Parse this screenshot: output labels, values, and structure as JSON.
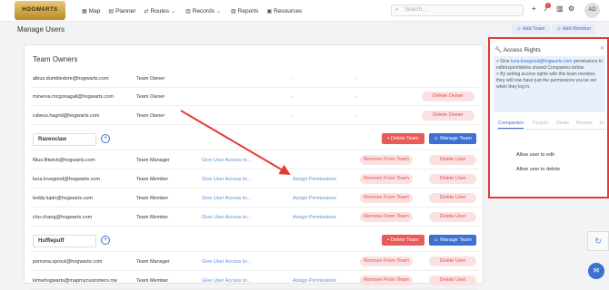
{
  "logo_text": "HOGWARTS",
  "nav": [
    {
      "label": "Map",
      "icon": "map-icon"
    },
    {
      "label": "Planner",
      "icon": "calendar-icon"
    },
    {
      "label": "Routes",
      "icon": "routes-icon"
    },
    {
      "label": "Records",
      "icon": "records-icon"
    },
    {
      "label": "Reports",
      "icon": "reports-icon"
    },
    {
      "label": "Resources",
      "icon": "resources-icon"
    }
  ],
  "search": {
    "placeholder": "Search..."
  },
  "notifications_count": "2",
  "avatar_initials": "AD",
  "page_title": "Manage Users",
  "actions": {
    "add_team": "Add Team",
    "add_member": "Add Member"
  },
  "owners": {
    "title": "Team Owners",
    "rows": [
      {
        "email": "albus.dumbledore@hogwarts.com",
        "role": "Team Owner",
        "action": "-",
        "perm": "-",
        "button": ""
      },
      {
        "email": "minerva.mcgonagall@hogwarts.com",
        "role": "Team Owner",
        "action": "-",
        "perm": "-",
        "button": "Delete Owner"
      },
      {
        "email": "rubeus.hagrid@hogwarts.com",
        "role": "Team Owner",
        "action": "-",
        "perm": "-",
        "button": "Delete Owner"
      }
    ]
  },
  "teams": [
    {
      "name": "Ravenclaw",
      "delete": "Delete Team",
      "manage": "Manage Team",
      "rows": [
        {
          "email": "filius.flitwick@hogwarts.com",
          "role": "Team Manager",
          "access": "Give User Access to...",
          "perm": "",
          "remove": "Remove From Team",
          "delete": "Delete User"
        },
        {
          "email": "luna.lovegood@hogwarts.com",
          "role": "Team Member",
          "access": "Give User Access to...",
          "perm": "Assign Permissions",
          "remove": "Remove From Team",
          "delete": "Delete User"
        },
        {
          "email": "teddy.lupin@hogwarts.com",
          "role": "Team Member",
          "access": "Give User Access to...",
          "perm": "Assign Permissions",
          "remove": "Remove From Team",
          "delete": "Delete User"
        },
        {
          "email": "cho.chang@hogwarts.com",
          "role": "Team Member",
          "access": "Give User Access to...",
          "perm": "Assign Permissions",
          "remove": "Remove From Team",
          "delete": "Delete User"
        }
      ]
    },
    {
      "name": "Hufflepuff",
      "delete": "Delete Team",
      "manage": "Manage Team",
      "rows": [
        {
          "email": "pomona.sprout@hogwarts.com",
          "role": "Team Manager",
          "access": "Give User Access to...",
          "perm": "",
          "remove": "Remove From Team",
          "delete": "Delete User"
        },
        {
          "email": "kimwhogwarts@mapmycustomers.me",
          "role": "Team Member",
          "access": "Give User Access to...",
          "perm": "Assign Permissions",
          "remove": "Remove From Team",
          "delete": "Delete User"
        }
      ]
    }
  ],
  "panel": {
    "title": "Access Rights",
    "notice_1a": "> Give ",
    "notice_link": "luna.lovegood@hogwarts.com",
    "notice_1b": " permissions to edit/export/delete shared Companies below.",
    "notice_2": "> By setting access rights with this team member, they will now have just the permissions you've set when they log in.",
    "tabs": [
      "Companies",
      "People",
      "Deals",
      "Routes",
      "Te"
    ],
    "permissions": [
      "Allow user to edit",
      "Allow user to delete"
    ]
  },
  "colors": {
    "accent": "#3f6fd1",
    "danger": "#e53935",
    "annotation": "#e53935"
  }
}
